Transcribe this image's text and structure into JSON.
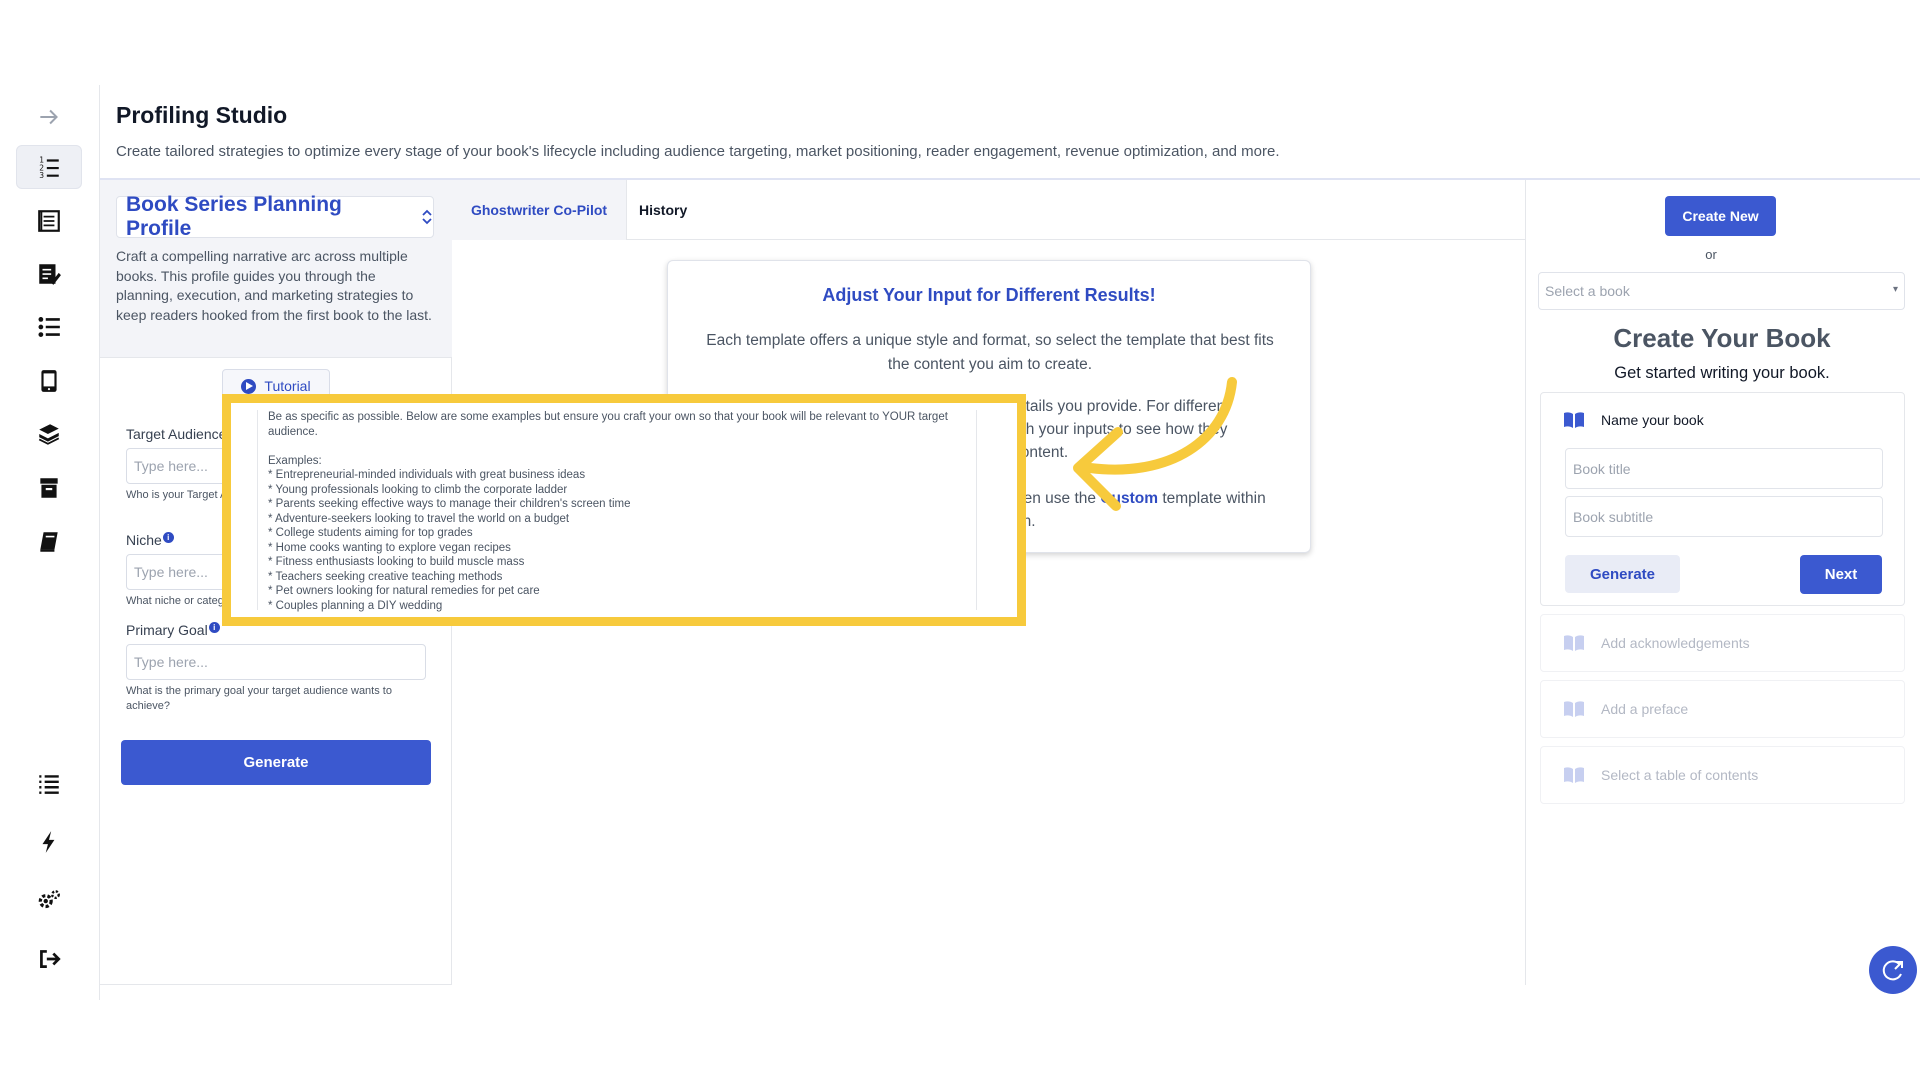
{
  "header": {
    "title": "Profiling Studio",
    "description": "Create tailored strategies to optimize every stage of your book's lifecycle including audience targeting, market positioning, reader engagement, revenue optimization, and more."
  },
  "rail": {
    "icons": [
      "arrow-right-icon",
      "ordered-list-icon",
      "book-list-icon",
      "edit-document-icon",
      "bullet-list-icon",
      "tablet-icon",
      "book-stack-icon",
      "archive-icon",
      "book-icon",
      "list-icon",
      "lightning-icon",
      "settings-icon",
      "logout-icon"
    ],
    "active_index": 1
  },
  "profile": {
    "name": "Book Series Planning Profile",
    "description": "Craft a compelling narrative arc across multiple books. This profile guides you through the planning, execution, and marketing strategies to keep readers hooked from the first book to the last.",
    "tutorial_label": "Tutorial"
  },
  "form": {
    "target_audience_label": "Target Audience",
    "target_audience_placeholder": "Type here...",
    "target_audience_help": "Who is your Target Audience for this book for?",
    "niche_label": "Niche",
    "niche_placeholder": "Type here...",
    "niche_help": "What niche or category does your book fit into?",
    "primary_goal_label": "Primary Goal",
    "primary_goal_placeholder": "Type here...",
    "primary_goal_help": "What is the primary goal your target audience wants to achieve?",
    "generate_label": "Generate"
  },
  "tabs": {
    "copilot": "Ghostwriter Co-Pilot",
    "history": "History"
  },
  "info_card": {
    "title": "Adjust Your Input for Different Results!",
    "para1": "Each template offers a unique style and format, so select the template that best fits the content you aim to create.",
    "para2_line1": "etails you provide. For different",
    "para2_line2": "ith your inputs to see how they",
    "para2_line3": "content.",
    "para3_prefix": "hen use the ",
    "para3_link": "Custom",
    "para3_suffix": " template within",
    "para3_line2": "on."
  },
  "tooltip": {
    "intro": "Be as specific as possible. Below are some examples but ensure you craft your own so that your book will be relevant to YOUR target audience.",
    "examples_heading": "Examples:",
    "examples": [
      "* Entrepreneurial-minded individuals with great business ideas",
      "* Young professionals looking to climb the corporate ladder",
      "* Parents seeking effective ways to manage their children's screen time",
      "* Adventure-seekers looking to travel the world on a budget",
      "* College students aiming for top grades",
      "* Home cooks wanting to explore vegan recipes",
      "* Fitness enthusiasts looking to build muscle mass",
      "* Teachers seeking creative teaching methods",
      "* Pet owners looking for natural remedies for pet care",
      "* Couples planning a DIY wedding"
    ]
  },
  "right": {
    "create_new_label": "Create New",
    "or_label": "or",
    "book_select_placeholder": "Select a book",
    "title": "Create Your Book",
    "subtitle": "Get started writing your book.",
    "name_step_label": "Name your book",
    "book_title_placeholder": "Book title",
    "book_subtitle_placeholder": "Book subtitle",
    "generate_label": "Generate",
    "next_label": "Next",
    "steps": [
      "Add acknowledgements",
      "Add a preface",
      "Select a table of contents"
    ]
  },
  "colors": {
    "accent": "#3b59d0",
    "highlight": "#f7ca3c"
  }
}
